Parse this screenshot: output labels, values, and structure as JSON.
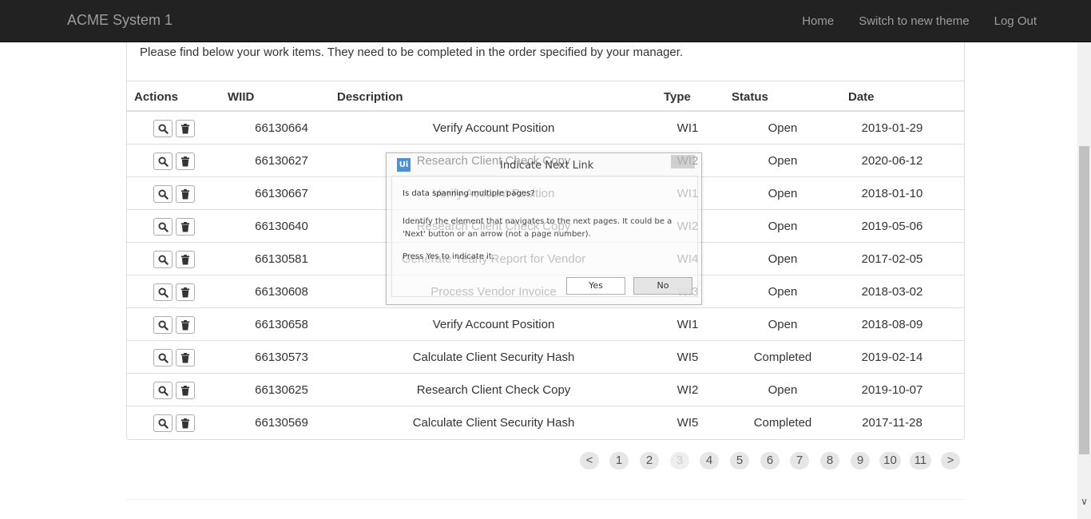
{
  "navbar": {
    "brand": "ACME System 1",
    "links": [
      "Home",
      "Switch to new theme",
      "Log Out"
    ]
  },
  "intro": "Please find below your work items. They need to be completed in the order specified by your manager.",
  "table": {
    "headers": [
      "Actions",
      "WIID",
      "Description",
      "Type",
      "Status",
      "Date"
    ],
    "rows": [
      {
        "wiid": "66130664",
        "desc": "Verify Account Position",
        "type": "WI1",
        "status": "Open",
        "date": "2019-01-29"
      },
      {
        "wiid": "66130627",
        "desc": "Research Client Check Copy",
        "type": "WI2",
        "status": "Open",
        "date": "2020-06-12"
      },
      {
        "wiid": "66130667",
        "desc": "Verify Account Position",
        "type": "WI1",
        "status": "Open",
        "date": "2018-01-10"
      },
      {
        "wiid": "66130640",
        "desc": "Research Client Check Copy",
        "type": "WI2",
        "status": "Open",
        "date": "2019-05-06"
      },
      {
        "wiid": "66130581",
        "desc": "Generate Yearly Report for Vendor",
        "type": "WI4",
        "status": "Open",
        "date": "2017-02-05"
      },
      {
        "wiid": "66130608",
        "desc": "Process Vendor Invoice",
        "type": "WI3",
        "status": "Open",
        "date": "2018-03-02"
      },
      {
        "wiid": "66130658",
        "desc": "Verify Account Position",
        "type": "WI1",
        "status": "Open",
        "date": "2018-08-09"
      },
      {
        "wiid": "66130573",
        "desc": "Calculate Client Security Hash",
        "type": "WI5",
        "status": "Completed",
        "date": "2019-02-14"
      },
      {
        "wiid": "66130625",
        "desc": "Research Client Check Copy",
        "type": "WI2",
        "status": "Open",
        "date": "2019-10-07"
      },
      {
        "wiid": "66130569",
        "desc": "Calculate Client Security Hash",
        "type": "WI5",
        "status": "Completed",
        "date": "2017-11-28"
      }
    ]
  },
  "pagination": {
    "prev": "<",
    "pages": [
      "1",
      "2",
      "3",
      "4",
      "5",
      "6",
      "7",
      "8",
      "9",
      "10",
      "11"
    ],
    "active": "3",
    "next": ">"
  },
  "dialog": {
    "app_icon": "Ui",
    "title": "Indicate Next Link",
    "question": "Is data spanning multiple pages?",
    "text_line1": "Identify the element that navigates to the next pages. It could be a",
    "text_line2": "'Next' button or an arrow (not a page number).",
    "text_press": "Press Yes to indicate it.",
    "yes_label": "Yes",
    "no_label": "No"
  },
  "icons": {
    "view": "search-icon",
    "delete": "trash-icon"
  },
  "colors": {
    "navbar_bg": "#222222",
    "nav_text": "#9d9d9d",
    "dialog_icon": "#2d7fd3"
  }
}
